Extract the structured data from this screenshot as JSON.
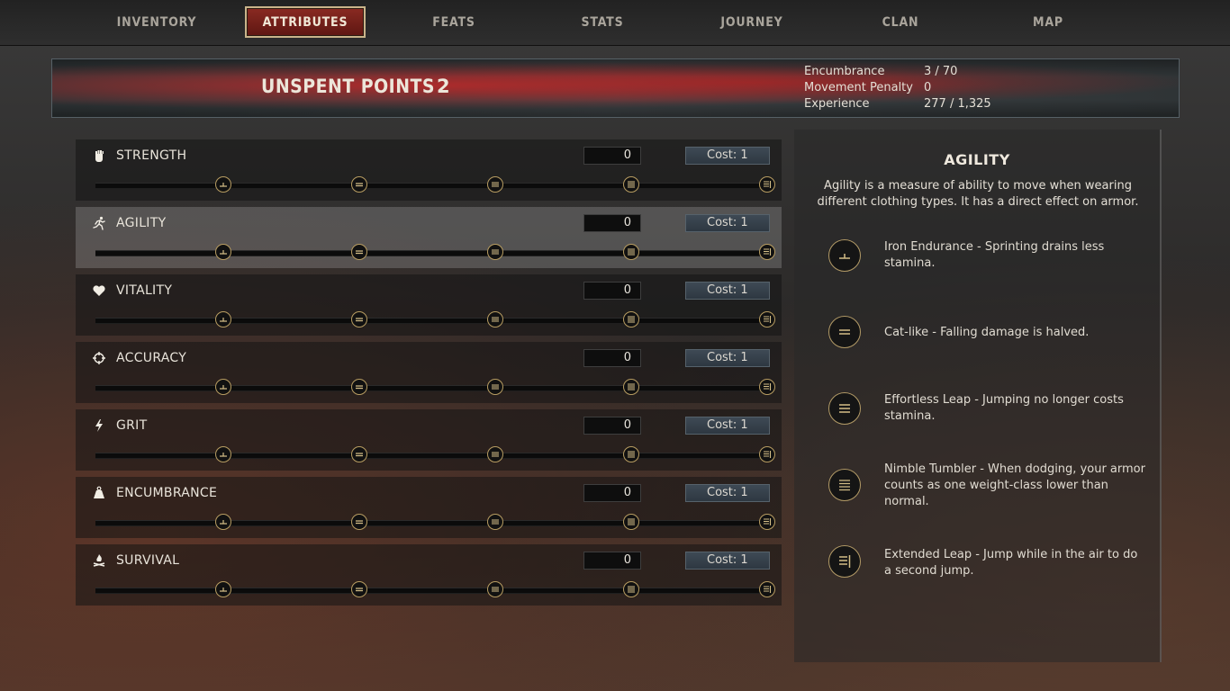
{
  "tabs": [
    {
      "label": "INVENTORY",
      "active": false
    },
    {
      "label": "ATTRIBUTES",
      "active": true
    },
    {
      "label": "FEATS",
      "active": false
    },
    {
      "label": "STATS",
      "active": false
    },
    {
      "label": "JOURNEY",
      "active": false
    },
    {
      "label": "CLAN",
      "active": false
    },
    {
      "label": "MAP",
      "active": false
    }
  ],
  "header": {
    "unspent_label": "UNSPENT POINTS",
    "unspent_value": "2",
    "stats": [
      {
        "label": "Encumbrance",
        "value": "3 / 70"
      },
      {
        "label": "Movement Penalty",
        "value": "0"
      },
      {
        "label": "Experience",
        "value": "277 / 1,325"
      }
    ]
  },
  "attributes": [
    {
      "name": "STRENGTH",
      "value": "0",
      "cost": "Cost: 1",
      "icon": "fist-icon",
      "selected": false
    },
    {
      "name": "AGILITY",
      "value": "0",
      "cost": "Cost: 1",
      "icon": "running-man-icon",
      "selected": true
    },
    {
      "name": "VITALITY",
      "value": "0",
      "cost": "Cost: 1",
      "icon": "heart-icon",
      "selected": false
    },
    {
      "name": "ACCURACY",
      "value": "0",
      "cost": "Cost: 1",
      "icon": "crosshair-icon",
      "selected": false
    },
    {
      "name": "GRIT",
      "value": "0",
      "cost": "Cost: 1",
      "icon": "lightning-icon",
      "selected": false
    },
    {
      "name": "ENCUMBRANCE",
      "value": "0",
      "cost": "Cost: 1",
      "icon": "weight-icon",
      "selected": false
    },
    {
      "name": "SURVIVAL",
      "value": "0",
      "cost": "Cost: 1",
      "icon": "campfire-icon",
      "selected": false
    }
  ],
  "detail": {
    "title": "AGILITY",
    "description": "Agility  is a measure of ability to move when wearing different clothing types. It has a direct effect on armor.",
    "perks": [
      {
        "text": "Iron Endurance - Sprinting drains less stamina.",
        "icon": "perk-tier1-icon"
      },
      {
        "text": "Cat-like - Falling damage is halved.",
        "icon": "perk-tier2-icon"
      },
      {
        "text": "Effortless Leap - Jumping no longer costs stamina.",
        "icon": "perk-tier3-icon"
      },
      {
        "text": "Nimble Tumbler - When dodging, your armor counts as one weight-class lower than normal.",
        "icon": "perk-tier4-icon"
      },
      {
        "text": "Extended Leap - Jump while in the air to do a second jump.",
        "icon": "perk-tier5-icon"
      }
    ]
  },
  "colors": {
    "accent_red": "#8a2a22",
    "gold_border": "#b89d62"
  }
}
